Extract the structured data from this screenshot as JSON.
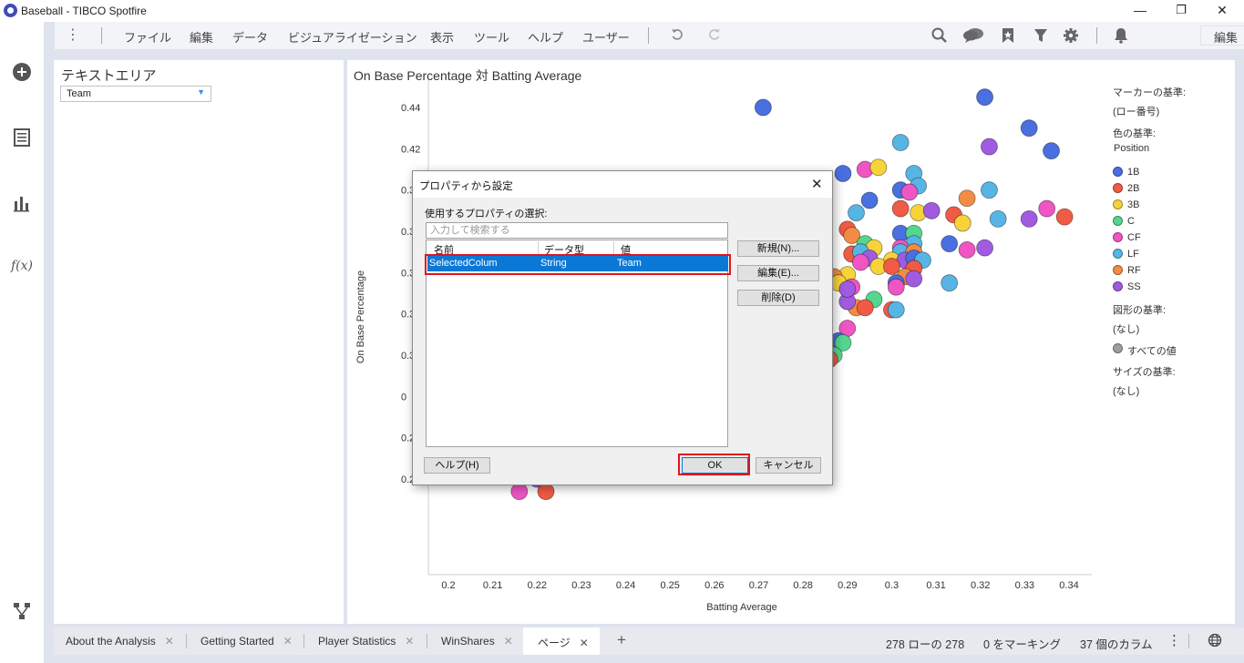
{
  "window": {
    "title": "Baseball - TIBCO Spotfire",
    "minimize": "—",
    "maximize": "❐",
    "close": "✕"
  },
  "menu": [
    "ファイル",
    "編集",
    "データ",
    "ビジュアライゼーション",
    "表示",
    "ツール",
    "ヘルプ",
    "ユーザー"
  ],
  "toolbar": {
    "mode": "編集"
  },
  "left_panel": {
    "title": "テキストエリア",
    "dropdown_value": "Team"
  },
  "viz": {
    "title": "On Base Percentage 対 Batting Average"
  },
  "legend": {
    "marker_by_label": "マーカーの基準:",
    "marker_by_value": "(ロー番号)",
    "color_by_label": "色の基準:",
    "color_by_value": "Position",
    "items": [
      {
        "name": "1B",
        "color": "#4a6fe0"
      },
      {
        "name": "2B",
        "color": "#ef5b45"
      },
      {
        "name": "3B",
        "color": "#f7d33a"
      },
      {
        "name": "C",
        "color": "#55d68e"
      },
      {
        "name": "CF",
        "color": "#ef55c3"
      },
      {
        "name": "LF",
        "color": "#56b5e4"
      },
      {
        "name": "RF",
        "color": "#f28b44"
      },
      {
        "name": "SS",
        "color": "#a05be0"
      }
    ],
    "shape_by_label": "図形の基準:",
    "shape_by_value": "(なし)",
    "all_values": "すべての値",
    "all_values_color": "#9e9e9e",
    "size_by_label": "サイズの基準:",
    "size_by_value": "(なし)"
  },
  "chart_data": {
    "type": "scatter",
    "title": "On Base Percentage 対 Batting Average",
    "xlabel": "Batting Average",
    "ylabel": "On Base Percentage",
    "xlim": [
      0.195,
      0.345
    ],
    "ylim": [
      0.25,
      0.45
    ],
    "x_ticks": [
      "0.2",
      "0.21",
      "0.22",
      "0.23",
      "0.24",
      "0.25",
      "0.26",
      "0.27",
      "0.28",
      "0.29",
      "0.3",
      "0.31",
      "0.32",
      "0.33",
      "0.34"
    ],
    "y_ticks": [
      "0.26",
      "0.28",
      "0",
      "0.3",
      "0.3",
      "0.3",
      "0.3",
      "0.3",
      "0.42",
      "0.44"
    ],
    "grid": false,
    "points": [
      {
        "x": 0.271,
        "y": 0.44,
        "c": "1B"
      },
      {
        "x": 0.321,
        "y": 0.445,
        "c": "1B"
      },
      {
        "x": 0.331,
        "y": 0.43,
        "c": "1B"
      },
      {
        "x": 0.336,
        "y": 0.419,
        "c": "1B"
      },
      {
        "x": 0.322,
        "y": 0.421,
        "c": "SS"
      },
      {
        "x": 0.302,
        "y": 0.423,
        "c": "LF"
      },
      {
        "x": 0.294,
        "y": 0.41,
        "c": "CF"
      },
      {
        "x": 0.297,
        "y": 0.411,
        "c": "3B"
      },
      {
        "x": 0.289,
        "y": 0.408,
        "c": "1B"
      },
      {
        "x": 0.305,
        "y": 0.408,
        "c": "LF"
      },
      {
        "x": 0.306,
        "y": 0.402,
        "c": "LF"
      },
      {
        "x": 0.302,
        "y": 0.4,
        "c": "1B"
      },
      {
        "x": 0.304,
        "y": 0.399,
        "c": "CF"
      },
      {
        "x": 0.322,
        "y": 0.4,
        "c": "LF"
      },
      {
        "x": 0.317,
        "y": 0.396,
        "c": "RF"
      },
      {
        "x": 0.295,
        "y": 0.395,
        "c": "1B"
      },
      {
        "x": 0.302,
        "y": 0.391,
        "c": "2B"
      },
      {
        "x": 0.306,
        "y": 0.389,
        "c": "3B"
      },
      {
        "x": 0.309,
        "y": 0.39,
        "c": "SS"
      },
      {
        "x": 0.314,
        "y": 0.388,
        "c": "2B"
      },
      {
        "x": 0.316,
        "y": 0.384,
        "c": "3B"
      },
      {
        "x": 0.324,
        "y": 0.386,
        "c": "LF"
      },
      {
        "x": 0.331,
        "y": 0.386,
        "c": "SS"
      },
      {
        "x": 0.335,
        "y": 0.391,
        "c": "CF"
      },
      {
        "x": 0.339,
        "y": 0.387,
        "c": "2B"
      },
      {
        "x": 0.292,
        "y": 0.389,
        "c": "LF"
      },
      {
        "x": 0.29,
        "y": 0.381,
        "c": "2B"
      },
      {
        "x": 0.291,
        "y": 0.378,
        "c": "RF"
      },
      {
        "x": 0.302,
        "y": 0.379,
        "c": "1B"
      },
      {
        "x": 0.305,
        "y": 0.379,
        "c": "C"
      },
      {
        "x": 0.305,
        "y": 0.374,
        "c": "LF"
      },
      {
        "x": 0.313,
        "y": 0.374,
        "c": "1B"
      },
      {
        "x": 0.317,
        "y": 0.371,
        "c": "CF"
      },
      {
        "x": 0.321,
        "y": 0.372,
        "c": "SS"
      },
      {
        "x": 0.294,
        "y": 0.374,
        "c": "C"
      },
      {
        "x": 0.296,
        "y": 0.372,
        "c": "3B"
      },
      {
        "x": 0.302,
        "y": 0.372,
        "c": "CF"
      },
      {
        "x": 0.302,
        "y": 0.37,
        "c": "LF"
      },
      {
        "x": 0.305,
        "y": 0.37,
        "c": "RF"
      },
      {
        "x": 0.291,
        "y": 0.369,
        "c": "2B"
      },
      {
        "x": 0.293,
        "y": 0.37,
        "c": "LF"
      },
      {
        "x": 0.295,
        "y": 0.367,
        "c": "SS"
      },
      {
        "x": 0.3,
        "y": 0.366,
        "c": "3B"
      },
      {
        "x": 0.303,
        "y": 0.366,
        "c": "SS"
      },
      {
        "x": 0.305,
        "y": 0.367,
        "c": "1B"
      },
      {
        "x": 0.307,
        "y": 0.366,
        "c": "LF"
      },
      {
        "x": 0.293,
        "y": 0.365,
        "c": "CF"
      },
      {
        "x": 0.297,
        "y": 0.363,
        "c": "3B"
      },
      {
        "x": 0.3,
        "y": 0.363,
        "c": "2B"
      },
      {
        "x": 0.305,
        "y": 0.362,
        "c": "2B"
      },
      {
        "x": 0.29,
        "y": 0.359,
        "c": "3B"
      },
      {
        "x": 0.303,
        "y": 0.358,
        "c": "RF"
      },
      {
        "x": 0.301,
        "y": 0.355,
        "c": "1B"
      },
      {
        "x": 0.313,
        "y": 0.355,
        "c": "LF"
      },
      {
        "x": 0.305,
        "y": 0.357,
        "c": "SS"
      },
      {
        "x": 0.301,
        "y": 0.353,
        "c": "CF"
      },
      {
        "x": 0.287,
        "y": 0.358,
        "c": "RF"
      },
      {
        "x": 0.291,
        "y": 0.353,
        "c": "CF"
      },
      {
        "x": 0.296,
        "y": 0.347,
        "c": "C"
      },
      {
        "x": 0.292,
        "y": 0.343,
        "c": "RF"
      },
      {
        "x": 0.294,
        "y": 0.343,
        "c": "2B"
      },
      {
        "x": 0.29,
        "y": 0.346,
        "c": "SS"
      },
      {
        "x": 0.3,
        "y": 0.342,
        "c": "2B"
      },
      {
        "x": 0.301,
        "y": 0.342,
        "c": "LF"
      },
      {
        "x": 0.29,
        "y": 0.333,
        "c": "CF"
      },
      {
        "x": 0.288,
        "y": 0.327,
        "c": "1B"
      },
      {
        "x": 0.289,
        "y": 0.326,
        "c": "C"
      },
      {
        "x": 0.287,
        "y": 0.32,
        "c": "C"
      },
      {
        "x": 0.286,
        "y": 0.318,
        "c": "2B"
      },
      {
        "x": 0.288,
        "y": 0.355,
        "c": "3B"
      },
      {
        "x": 0.29,
        "y": 0.352,
        "c": "SS"
      },
      {
        "x": 0.202,
        "y": 0.279,
        "c": "LF"
      },
      {
        "x": 0.203,
        "y": 0.265,
        "c": "RF"
      },
      {
        "x": 0.214,
        "y": 0.28,
        "c": "RF"
      },
      {
        "x": 0.222,
        "y": 0.28,
        "c": "LF"
      },
      {
        "x": 0.222,
        "y": 0.271,
        "c": "CF"
      },
      {
        "x": 0.22,
        "y": 0.26,
        "c": "SS"
      },
      {
        "x": 0.216,
        "y": 0.254,
        "c": "CF"
      },
      {
        "x": 0.222,
        "y": 0.254,
        "c": "2B"
      },
      {
        "x": 0.236,
        "y": 0.283,
        "c": "3B"
      },
      {
        "x": 0.242,
        "y": 0.283,
        "c": "C"
      },
      {
        "x": 0.25,
        "y": 0.276,
        "c": "2B"
      },
      {
        "x": 0.255,
        "y": 0.274,
        "c": "3B"
      },
      {
        "x": 0.257,
        "y": 0.278,
        "c": "2B"
      },
      {
        "x": 0.257,
        "y": 0.28,
        "c": "RF"
      }
    ]
  },
  "tabs": [
    {
      "label": "About the Analysis",
      "close": "✕"
    },
    {
      "label": "Getting Started",
      "close": "✕"
    },
    {
      "label": "Player Statistics",
      "close": "✕"
    },
    {
      "label": "WinShares",
      "close": "✕"
    },
    {
      "label": "ページ",
      "close": "✕"
    }
  ],
  "add_tab": "+",
  "status": {
    "rows": "278 ローの 278",
    "marked": "0 をマーキング",
    "columns": "37 個のカラム"
  },
  "dialog": {
    "title": "プロパティから設定",
    "close": "✕",
    "label": "使用するプロパティの選択:",
    "search_placeholder": "入力して検索する",
    "columns": [
      "名前",
      "データ型",
      "値"
    ],
    "rows": [
      {
        "name": "SelectedColum",
        "type": "String",
        "value": "Team"
      }
    ],
    "new_button": "新規(N)...",
    "edit_button": "編集(E)...",
    "delete_button": "削除(D)",
    "help_button": "ヘルプ(H)",
    "ok_button": "OK",
    "cancel_button": "キャンセル"
  }
}
